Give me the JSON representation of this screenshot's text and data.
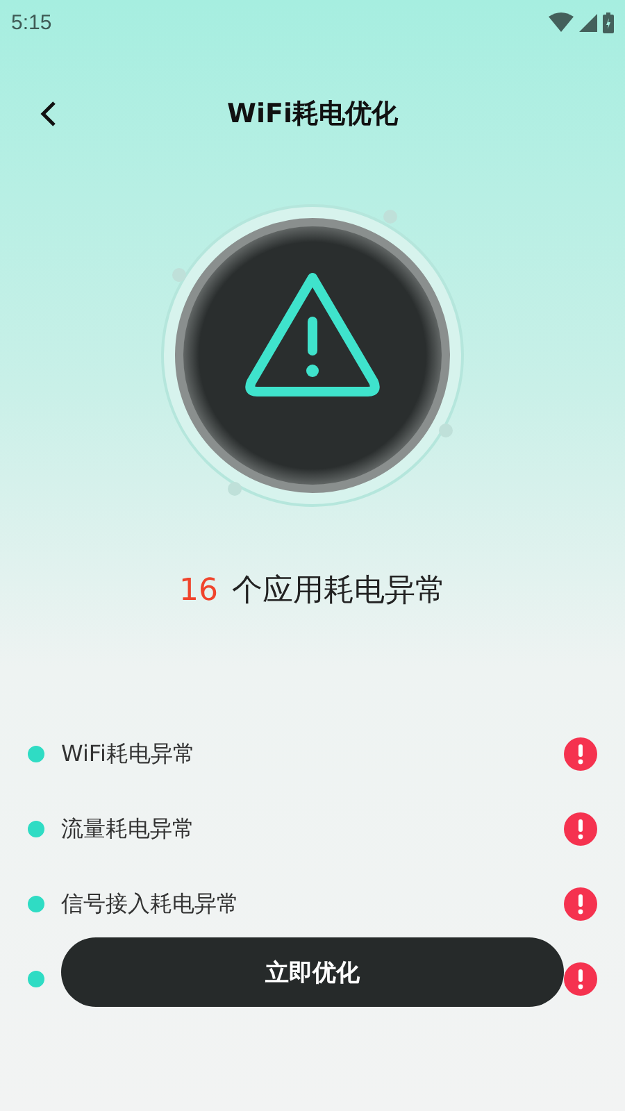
{
  "status_bar": {
    "time": "5:15"
  },
  "header": {
    "title": "WiFi耗电优化"
  },
  "summary": {
    "count": "16",
    "text": "个应用耗电异常"
  },
  "issues": [
    {
      "kind": "labeled",
      "label": "WiFi耗电异常"
    },
    {
      "kind": "labeled",
      "label": "流量耗电异常"
    },
    {
      "kind": "labeled",
      "label": "信号接入耗电异常"
    },
    {
      "kind": "covered"
    }
  ],
  "action_button": {
    "label": "立即优化"
  }
}
